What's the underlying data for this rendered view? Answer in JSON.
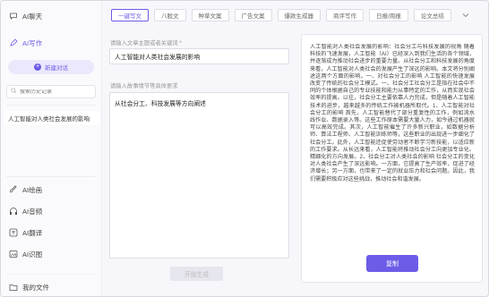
{
  "sidebar": {
    "items_top": [
      {
        "label": "AI聊天",
        "icon": "chat-icon"
      },
      {
        "label": "AI写作",
        "icon": "pen-icon"
      }
    ],
    "new_chat_label": "新建对话",
    "search_placeholder": "搜索历史记录",
    "history": [
      {
        "label": "人工智能对人类社会发展的影响"
      }
    ],
    "items_bottom": [
      {
        "label": "AI绘画",
        "icon": "paint-icon"
      },
      {
        "label": "AI音频",
        "icon": "headphones-icon"
      },
      {
        "label": "AI翻译",
        "icon": "translate-icon"
      },
      {
        "label": "AI识图",
        "icon": "image-icon"
      }
    ],
    "footer_label": "我的文件"
  },
  "tabs": [
    {
      "label": "一键写文"
    },
    {
      "label": "八股文"
    },
    {
      "label": "种草文案"
    },
    {
      "label": "广告文案"
    },
    {
      "label": "爆款生成器"
    },
    {
      "label": "商评写作"
    },
    {
      "label": "日报/周报"
    },
    {
      "label": "论文总结"
    }
  ],
  "form": {
    "title_label": "请输入文章主题或者关键词 *",
    "title_value": "人工智能对人类社会发展的影响",
    "content_label": "请输入故事情节等具体要求",
    "content_value": "从社会分工、科技发展等方向阐述",
    "generate_label": "开始生成"
  },
  "output": {
    "text": "人工智能对人类社会发展的影响：社会分工与科技发展的视角 随着科技的飞速发展，人工智能（AI）已经深入到我们生活的各个领域，并逐渐成为推动社会进步的重要力量。从社会分工和科技发展的角度来看，人工智能对人类社会的发展产生了深远的影响。本文将分别阐述这两个方面的影响。一、对社会分工的影响 人工智能的快速发展改变了传统的社会分工模式。一、社会分工社会分工是指在社会中不同的个体根据自己的专业技能和能力从事特定的工作，从而实现社会效率的提高。以往，社会分工主要依靠人力完成，但是随着人工智能技术的进步，越来越多的传统工作被机器所取代。1、人工智能对社会分工的影响 首先，人工智能替代了部分重复性的工作，例如流水线作业、数据录入等。这些工作原本需要大量人力，如今通过机器就可以高效完成。其次，人工智能催生了许多新兴职业，如数据分析师、算法工程师、人工智能训练师等，这些职业的出现进一步细化了社会分工。此外，人工智能还促使劳动者不断学习新技能，以适应新的工作要求。从长远来看，人工智能将推动社会分工向更加专业化、精细化的方向发展。2、社会分工对人类社会的影响 社会分工的变化对人类社会产生了深远影响。一方面，它提高了生产效率，促进了经济增长；另一方面，也带来了一定的就业压力和社会问题。因此，我们需要积极应对这些挑战，推动社会和谐发展。",
    "copy_label": "复制"
  },
  "colors": {
    "accent": "#6c5ce7",
    "accent_light": "#ebe8fb"
  }
}
